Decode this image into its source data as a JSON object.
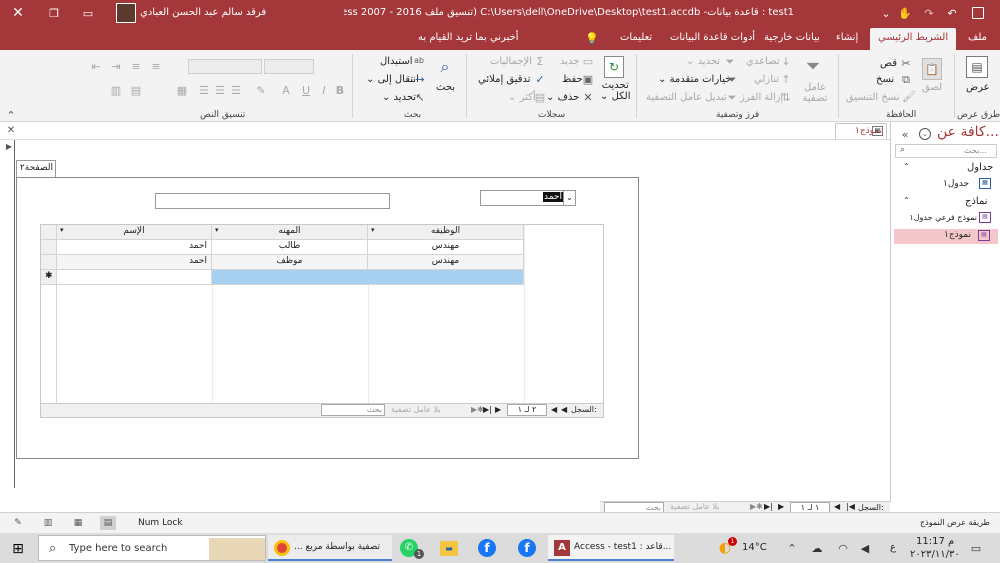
{
  "window": {
    "app": "Access",
    "title": "test1 : قاعدة بيانات- C:\\Users\\dell\\OneDrive\\Desktop\\test1.accdb (تنسيق ملف Access 2007 - 2016)",
    "user": "فرقد سالم عبد الحسن العبادي"
  },
  "tabs": [
    "ملف",
    "الشريط الرئيسي",
    "إنشاء",
    "بيانات خارجية",
    "أدوات قاعدة البيانات",
    "تعليمات",
    "أخبرني بما تريد القيام به"
  ],
  "ribbon": {
    "view": "عرض",
    "view_group": "طرق عرض",
    "paste": "لصق",
    "cut": "قص",
    "copy": "نسخ",
    "format_painter": "نسخ التنسيق",
    "clipboard_group": "الحافظة",
    "filter": "عامل تصفية",
    "ascending": "تصاعدي",
    "descending": "تنازلي",
    "remove_sort": "إزالة الفرز",
    "selection": "تحديد",
    "advanced": "خيارات متقدمة",
    "toggle_filter": "تبديل عامل التصفية",
    "sort_group": "فرز وتصفية",
    "refresh": "تحديث",
    "refresh_all": "الكل",
    "new": "جديد",
    "save": "حفظ",
    "delete": "حذف",
    "totals": "الإجماليات",
    "spelling": "تدقيق إملائي",
    "more": "أكثر",
    "records_group": "سجلات",
    "find": "بحث",
    "replace": "استبدال",
    "goto": "انتقال إلى",
    "select": "تحديد",
    "find_group": "بحث",
    "text_group": "تنسيق النص"
  },
  "nav": {
    "title": "كافة عن...",
    "search_placeholder": "بحث...",
    "tables_header": "جداول",
    "table1": "جدول١",
    "forms_header": "نماذج",
    "form_sub": "نموذج فرعي جدول١",
    "form1": "نموذج١"
  },
  "doc_tab": "نموذج١",
  "form": {
    "page_tab": "الصفحة٢",
    "combo_value": "احمد",
    "columns": [
      "الإسم",
      "المهنه",
      "الوظيفه"
    ],
    "rows": [
      [
        "احمد",
        "طالب",
        "مهندس"
      ],
      [
        "احمد",
        "موظف",
        "مهندس"
      ]
    ],
    "sub_nav": {
      "label": "السجل:",
      "position": "٢ لـ ١",
      "no_filter": "بلا عامل تصفية",
      "search": "بحث"
    }
  },
  "main_nav": {
    "label": "السجل:",
    "position": "١ لـ ١",
    "no_filter": "بلا عامل تصفية",
    "search": "بحث"
  },
  "status": {
    "num_lock": "Num Lock",
    "view_name": "طريقة عرض النموذج"
  },
  "taskbar": {
    "search_placeholder": "Type here to search",
    "chrome_tab": "تصفية بواسطة مربع ...",
    "access_tab": "Access - test1 : قاعد...",
    "weather": "14°C",
    "lang": "ع",
    "time": "11:17 م",
    "date": "٢٠٢٣/١١/٣٠",
    "whatsapp_badge": "1",
    "weather_badge": "1"
  }
}
